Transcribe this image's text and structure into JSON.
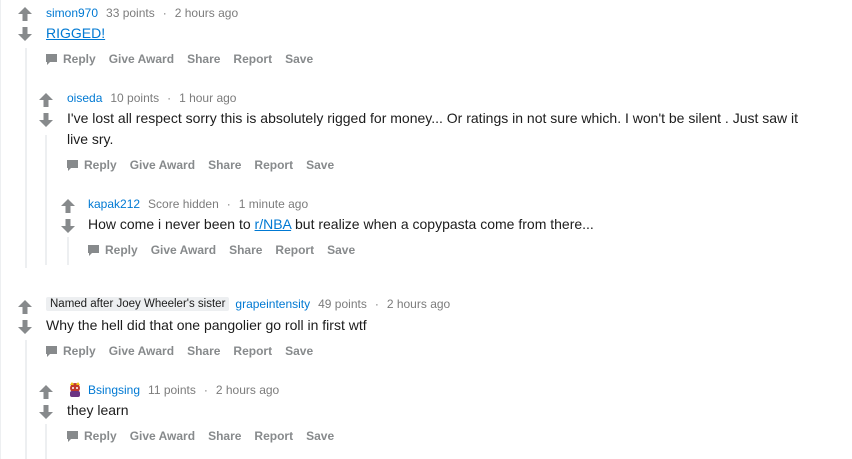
{
  "comments": [
    {
      "author": "simon970",
      "score": "33 points",
      "time": "2 hours ago",
      "body": "RIGGED!"
    },
    {
      "author": "oiseda",
      "score": "10 points",
      "time": "1 hour ago",
      "body_line1": "I've lost all respect sorry this is absolutely rigged for money... Or ratings in not sure which. I won't be silent . Just saw it",
      "body_line2": "live sry."
    },
    {
      "author": "kapak212",
      "score": "Score hidden",
      "time": "1 minute ago",
      "body_pre": "How come i never been to ",
      "body_link": "r/NBA",
      "body_post": " but realize when a copypasta come from there..."
    },
    {
      "flair": "Named after Joey Wheeler's sister",
      "author": "grapeintensity",
      "score": "49 points",
      "time": "2 hours ago",
      "body": "Why the hell did that one pangolier go roll in first wtf"
    },
    {
      "author": "Bsingsing",
      "score": "11 points",
      "time": "2 hours ago",
      "body": "they learn"
    }
  ],
  "actions": {
    "reply": "Reply",
    "give_award": "Give Award",
    "share": "Share",
    "report": "Report",
    "save": "Save"
  },
  "separator": "·",
  "colors": {
    "author": "#0079d3",
    "meta": "#7c7c7c",
    "action": "#878a8c",
    "thread_line": "#edeff1",
    "arrow": "#878a8c"
  },
  "icons": [
    "upvote-icon",
    "downvote-icon",
    "reply-icon",
    "avatar-icon"
  ]
}
